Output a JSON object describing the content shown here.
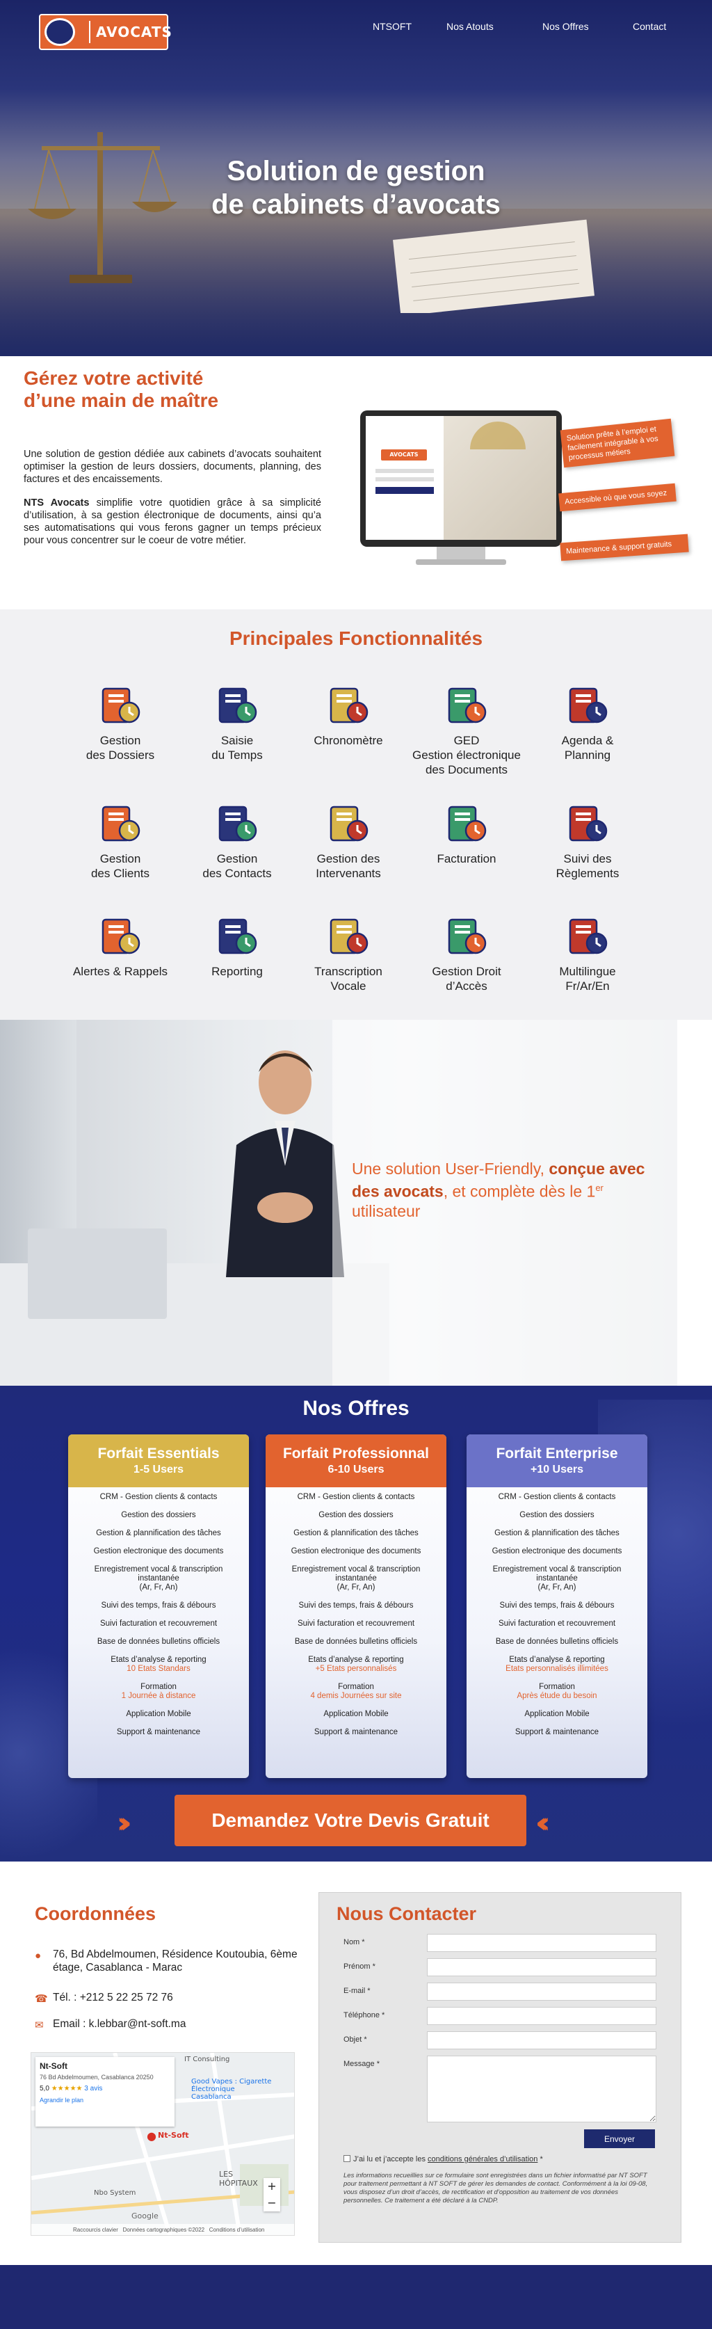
{
  "brand": {
    "name": "AVOCATS"
  },
  "nav": [
    {
      "label": "NTSOFT"
    },
    {
      "label": "Nos Atouts"
    },
    {
      "label": "Nos Offres"
    },
    {
      "label": "Contact"
    }
  ],
  "hero": {
    "title_line1": "Solution de gestion",
    "title_line2": "de cabinets d’avocats"
  },
  "about": {
    "heading_line1": "Gérez votre activité",
    "heading_line2": "d’une main de maître",
    "p1": "Une solution de gestion dédiée aux cabinets d’avocats souhaitent optimiser la gestion de leurs dossiers, documents, planning, des factures et des encaissements.",
    "p2_bold": "NTS Avocats",
    "p2": " simplifie votre quotidien grâce à sa simplicité d’utilisation, à sa gestion électronique de documents, ainsi qu’a ses automatisations qui vous ferons gagner un temps précieux pour vous concentrer sur le coeur de votre métier.",
    "tags": [
      "Solution prête à l’emploi et facilement intégrable à vos processus métiers",
      "Accessible où que vous soyez",
      "Maintenance & support gratuits"
    ],
    "screen_brand": "AVOCATS"
  },
  "features": {
    "title": "Principales Fonctionnalités",
    "items": [
      {
        "label": "Gestion\ndes Dossiers",
        "icon": "folders-icon"
      },
      {
        "label": "Saisie\ndu Temps",
        "icon": "timesheet-icon"
      },
      {
        "label": "Chronomètre",
        "icon": "stopwatch-icon"
      },
      {
        "label": "GED\nGestion électronique\ndes Documents",
        "icon": "document-search-icon"
      },
      {
        "label": "Agenda &\nPlanning",
        "icon": "calendar-icon"
      },
      {
        "label": "Gestion\ndes Clients",
        "icon": "clients-icon"
      },
      {
        "label": "Gestion\ndes Contacts",
        "icon": "contacts-book-icon"
      },
      {
        "label": "Gestion des\nIntervenants",
        "icon": "lawyer-icon"
      },
      {
        "label": "Facturation",
        "icon": "invoice-calculator-icon"
      },
      {
        "label": "Suivi des\nRèglements",
        "icon": "payments-icon"
      },
      {
        "label": "Alertes & Rappels",
        "icon": "bell-alerts-icon"
      },
      {
        "label": "Reporting",
        "icon": "reporting-board-icon"
      },
      {
        "label": "Transcription\nVocale",
        "icon": "microphone-icon"
      },
      {
        "label": "Gestion Droit\nd’Accès",
        "icon": "access-lock-icon"
      },
      {
        "label": "Multilingue\nFr/Ar/En",
        "icon": "language-icon"
      }
    ]
  },
  "user_friendly": {
    "part1": "Une solution User-Friendly, ",
    "bold": "conçue avec des avocats",
    "part2": ", et complète dès le 1",
    "sup": "er",
    "part3": " utilisateur"
  },
  "offers": {
    "title": "Nos Offres",
    "plans": [
      {
        "name": "Forfait Essentials",
        "users": "1-5 Users",
        "color": "#d8b54a",
        "formation_detail": "1 Journée à distance",
        "reporting_detail": "10 Etats Standars"
      },
      {
        "name": "Forfait Professionnal",
        "users": "6-10 Users",
        "color": "#e2632f",
        "formation_detail": "4 demis Journées sur site",
        "reporting_detail": "+5 Etats personnalisés"
      },
      {
        "name": "Forfait Enterprise",
        "users": "+10 Users",
        "color": "#6b72c8",
        "formation_detail": "Après étude du besoin",
        "reporting_detail": "Etats personnalisés illimitées"
      }
    ],
    "features": [
      "CRM - Gestion clients & contacts",
      "Gestion des dossiers",
      "Gestion & plannification des tâches",
      "Gestion electronique des documents",
      "Enregistrement vocal & transcription instantanée\n(Ar, Fr, An)",
      "Suivi des temps, frais & débours",
      "Suivi facturation et recouvrement",
      "Base de données bulletins officiels",
      "Etats d’analyse & reporting",
      "Formation",
      "Application Mobile",
      "Support & maintenance"
    ],
    "cta": "Demandez Votre Devis Gratuit"
  },
  "contact": {
    "coords_title": "Coordonnées",
    "address": "76, Bd Abdelmoumen, Résidence Koutoubia, 6ème étage, Casablanca - Marac",
    "phone": "Tél. : +212 5 22 25 72 76",
    "email": "Email : k.lebbar@nt-soft.ma",
    "map": {
      "place": "Nt-Soft",
      "place_address": "76 Bd Abdelmoumen, Casablanca 20250",
      "rating": "5,0",
      "reviews": "3 avis",
      "enlarge": "Agrandir le plan",
      "labels": [
        "IT Consulting",
        "Good Vapes : Cigarette Électronique Casablanca",
        "Nt-Soft",
        "LES HÔPITAUX",
        "Nbo System",
        "Google"
      ],
      "footer": [
        "Raccourcis clavier",
        "Données cartographiques ©2022",
        "Conditions d’utilisation"
      ]
    },
    "form_title": "Nous Contacter",
    "fields": [
      {
        "label": "Nom *"
      },
      {
        "label": "Prénom *"
      },
      {
        "label": "E-mail *"
      },
      {
        "label": "Téléphone *"
      },
      {
        "label": "Objet *"
      },
      {
        "label": "Message *"
      }
    ],
    "send": "Envoyer",
    "consent_pre": "J’ai lu et j’accepte les ",
    "consent_link": "conditions générales d’utilisation",
    "consent_post": " *",
    "legal": "Les informations recueillies sur ce formulaire sont enregistrées dans un fichier informatisé par NT SOFT pour traitement permettant à NT SOFT de gérer les demandes de contact. Conformément à la loi 09-08, vous disposez d’un droit d’accès, de rectification et d’opposition au traitement de vos données personnelles. Ce traitement a été déclaré à la CNDP."
  },
  "colors": {
    "navy": "#1f2870",
    "accent": "#e2632f",
    "heading": "#d2562a"
  }
}
